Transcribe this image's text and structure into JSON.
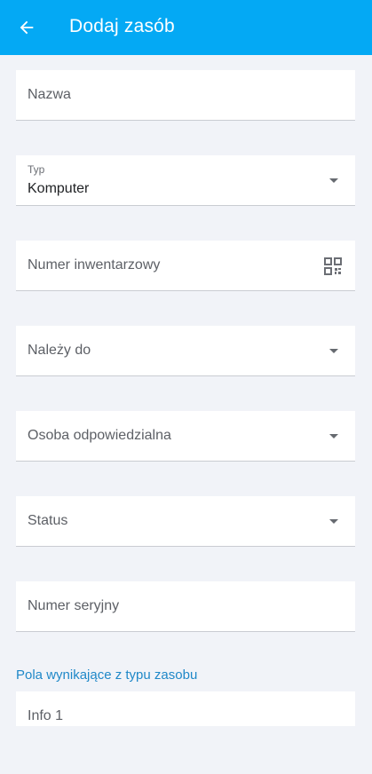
{
  "header": {
    "title": "Dodaj zasób",
    "back_icon": "arrow-back-icon",
    "color": "#04a9f4"
  },
  "form": {
    "name": {
      "label": "Nazwa"
    },
    "type": {
      "label": "Typ",
      "value": "Komputer"
    },
    "inventory_number": {
      "label": "Numer inwentarzowy",
      "icon": "qr-code-icon"
    },
    "belongs_to": {
      "label": "Należy do"
    },
    "responsible_person": {
      "label": "Osoba odpowiedzialna"
    },
    "status": {
      "label": "Status"
    },
    "serial_number": {
      "label": "Numer seryjny"
    }
  },
  "type_fields": {
    "section_title": "Pola wynikające z typu zasobu",
    "section_color": "#1f88c8",
    "info1": {
      "label": "Info 1"
    }
  }
}
